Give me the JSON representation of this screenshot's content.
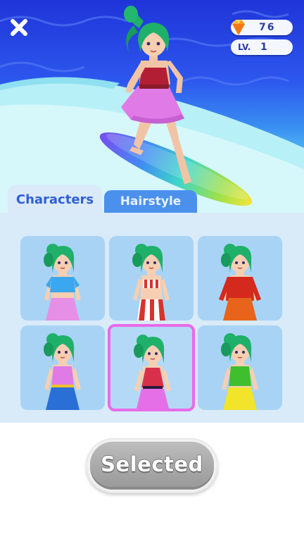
{
  "hud": {
    "close_icon": "close-x-icon",
    "gems": {
      "icon": "diamond-icon",
      "value": "76"
    },
    "level": {
      "label": "LV.",
      "value": "1"
    }
  },
  "tabs": [
    {
      "label": "Characters",
      "active": true
    },
    {
      "label": "Hairstyle",
      "active": false
    }
  ],
  "characters": [
    {
      "top": "blue-crop-top",
      "top_color": "#3aa7ee",
      "bottom_color": "#e58fe6",
      "selected": false
    },
    {
      "top": "striped-bikini",
      "top_color": "#d8322f",
      "bottom_color": "#d8322f",
      "selected": false
    },
    {
      "top": "red-hoodie",
      "top_color": "#d42a1e",
      "bottom_color": "#e8641a",
      "selected": false
    },
    {
      "top": "pink-tank",
      "top_color": "#e07ae6",
      "bottom_color": "#2a6fd6",
      "selected": false
    },
    {
      "top": "red-halter",
      "top_color": "#d8304a",
      "bottom_color": "#e56fe6",
      "selected": true
    },
    {
      "top": "green-tank",
      "top_color": "#3fbf2e",
      "bottom_color": "#f1e42a",
      "selected": false
    }
  ],
  "action_button": {
    "label": "Selected"
  },
  "colors": {
    "accent": "#2f5fd6",
    "selected_border": "#e86be8",
    "card_bg": "#a8d3f5",
    "hair": "#1fb06a"
  }
}
